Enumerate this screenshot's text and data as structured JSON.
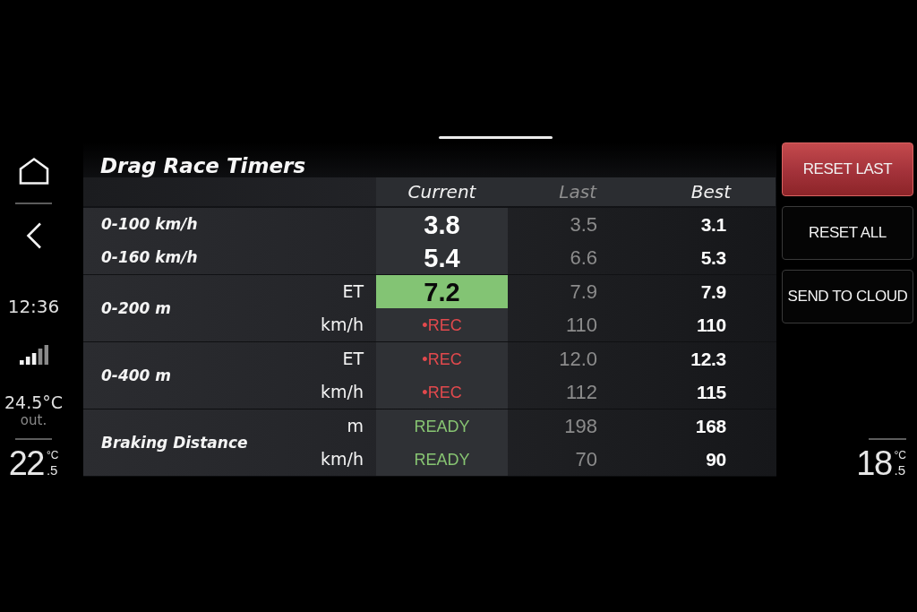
{
  "sidebar": {
    "time": "12:36",
    "outside_temperature": "24.5°C",
    "outside_caption": "out.",
    "climate": {
      "value": "22",
      "unit": "°C",
      "decimal": ".5"
    }
  },
  "title": "Drag Race Timers",
  "table": {
    "columns": [
      "Current",
      "Last",
      "Best"
    ],
    "groups": [
      {
        "rows": [
          {
            "label": "0-100 km/h",
            "current": {
              "text": "3.8",
              "kind": "value",
              "highlighted": false
            },
            "last": "3.5",
            "best": "3.1"
          },
          {
            "label": "0-160 km/h",
            "current": {
              "text": "5.4",
              "kind": "value",
              "highlighted": false
            },
            "last": "6.6",
            "best": "5.3"
          }
        ]
      },
      {
        "label": "0-200 m",
        "rows": [
          {
            "unit": "ET",
            "current": {
              "text": "7.2",
              "kind": "value",
              "highlighted": true
            },
            "last": "7.9",
            "best": "7.9"
          },
          {
            "unit": "km/h",
            "current": {
              "text": "•REC",
              "kind": "recording",
              "highlighted": false
            },
            "last": "110",
            "best": "110"
          }
        ]
      },
      {
        "label": "0-400 m",
        "rows": [
          {
            "unit": "ET",
            "current": {
              "text": "•REC",
              "kind": "recording",
              "highlighted": false
            },
            "last": "12.0",
            "best": "12.3"
          },
          {
            "unit": "km/h",
            "current": {
              "text": "•REC",
              "kind": "recording",
              "highlighted": false
            },
            "last": "112",
            "best": "115"
          }
        ]
      },
      {
        "label": "Braking Distance",
        "rows": [
          {
            "unit": "m",
            "current": {
              "text": "READY",
              "kind": "ready",
              "highlighted": false
            },
            "last": "198",
            "best": "168"
          },
          {
            "unit": "km/h",
            "current": {
              "text": "READY",
              "kind": "ready",
              "highlighted": false
            },
            "last": "70",
            "best": "90"
          }
        ]
      }
    ]
  },
  "buttons": [
    {
      "label": "RESET LAST",
      "highlighted": true
    },
    {
      "label": "RESET ALL",
      "highlighted": false
    },
    {
      "label": "SEND TO CLOUD",
      "highlighted": false
    }
  ],
  "right_climate": {
    "value": "18",
    "unit": "°C",
    "decimal": ".5"
  }
}
